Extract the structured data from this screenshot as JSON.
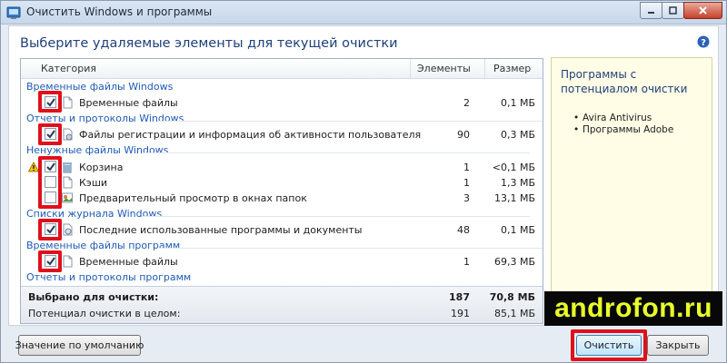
{
  "window": {
    "title": "Очистить Windows и программы"
  },
  "heading": "Выберите удаляемые элементы для текущей очистки",
  "columns": {
    "category": "Категория",
    "count": "Элементы",
    "size": "Размер"
  },
  "groups": [
    {
      "title": "Временные файлы Windows",
      "items": [
        {
          "label": "Временные файлы",
          "count": "2",
          "size": "0,1 МБ",
          "checked": true,
          "icon": "file-icon"
        }
      ]
    },
    {
      "title": "Отчеты и протоколы Windows",
      "items": [
        {
          "label": "Файлы регистрации и информация об активности пользователя",
          "count": "90",
          "size": "0,3 МБ",
          "checked": true,
          "icon": "log-file-icon"
        }
      ]
    },
    {
      "title": "Ненужные файлы Windows",
      "items": [
        {
          "label": "Корзина",
          "count": "1",
          "size": "<0,1 МБ",
          "checked": true,
          "icon": "recycle-bin-icon",
          "warning": true
        },
        {
          "label": "Кэши",
          "count": "1",
          "size": "1,3 МБ",
          "checked": false,
          "icon": "file-icon"
        },
        {
          "label": "Предварительный просмотр в окнах папок",
          "count": "3",
          "size": "13,1 МБ",
          "checked": false,
          "icon": "folder-preview-icon"
        }
      ]
    },
    {
      "title": "Списки журнала Windows",
      "items": [
        {
          "label": "Последние использованные программы и документы",
          "count": "48",
          "size": "0,1 МБ",
          "checked": true,
          "icon": "history-icon"
        }
      ]
    },
    {
      "title": "Временные файлы программ",
      "items": [
        {
          "label": "Временные файлы",
          "count": "1",
          "size": "69,3 МБ",
          "checked": true,
          "icon": "file-icon"
        }
      ]
    },
    {
      "title": "Отчеты и протоколы программ",
      "items": []
    }
  ],
  "summary": {
    "selected_label": "Выбрано для очистки:",
    "selected_count": "187",
    "selected_size": "70,8 МБ",
    "potential_label": "Потенциал очистки в целом:",
    "potential_count": "191",
    "potential_size": "85,1 МБ"
  },
  "side_panel": {
    "title": "Программы с потенциалом очистки",
    "programs": [
      "Avira Antivirus",
      "Программы Adobe"
    ]
  },
  "buttons": {
    "default": "Значение по умолчанию",
    "clean": "Очистить",
    "close": "Закрыть"
  },
  "watermark": "androfon.ru",
  "colors": {
    "highlight": "#e0101b",
    "group_title": "#1f5bb5",
    "heading": "#1f3f7a",
    "side_panel_bg": "#fffde6"
  }
}
